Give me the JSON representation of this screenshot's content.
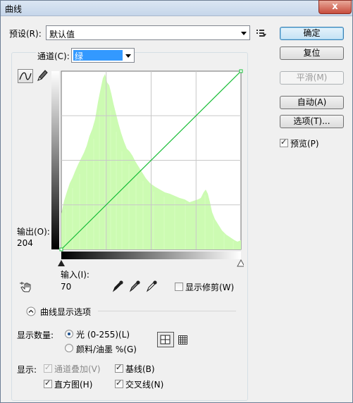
{
  "window": {
    "title": "曲线",
    "close_label": "x"
  },
  "preset": {
    "label": "预设(R):",
    "value": "默认值"
  },
  "channel": {
    "label": "通道(C):",
    "value": "绿",
    "highlight": "#3399ff"
  },
  "buttons": {
    "ok": "确定",
    "reset": "复位",
    "smooth": "平滑(M)",
    "auto": "自动(A)",
    "options": "选项(T)..."
  },
  "preview": {
    "label": "预览(P)",
    "checked": true
  },
  "curve_graph": {
    "output_label": "输出(O):",
    "output_value": "204",
    "input_label": "输入(I):",
    "input_value": "70",
    "histogram_color": "#ccfbb2",
    "curve_color": "#18c238"
  },
  "clipping": {
    "label": "显示修剪(W)",
    "checked": false
  },
  "display_options": {
    "section_label": "曲线显示选项",
    "amount_label": "显示数量:",
    "light_label": "光 (0-255)(L)",
    "pigment_label": "颜料/油墨 %(G)",
    "show_label": "显示:",
    "channel_overlay": "通道叠加(V)",
    "baseline": "基线(B)",
    "histogram": "直方图(H)",
    "intersection": "交叉线(N)"
  }
}
